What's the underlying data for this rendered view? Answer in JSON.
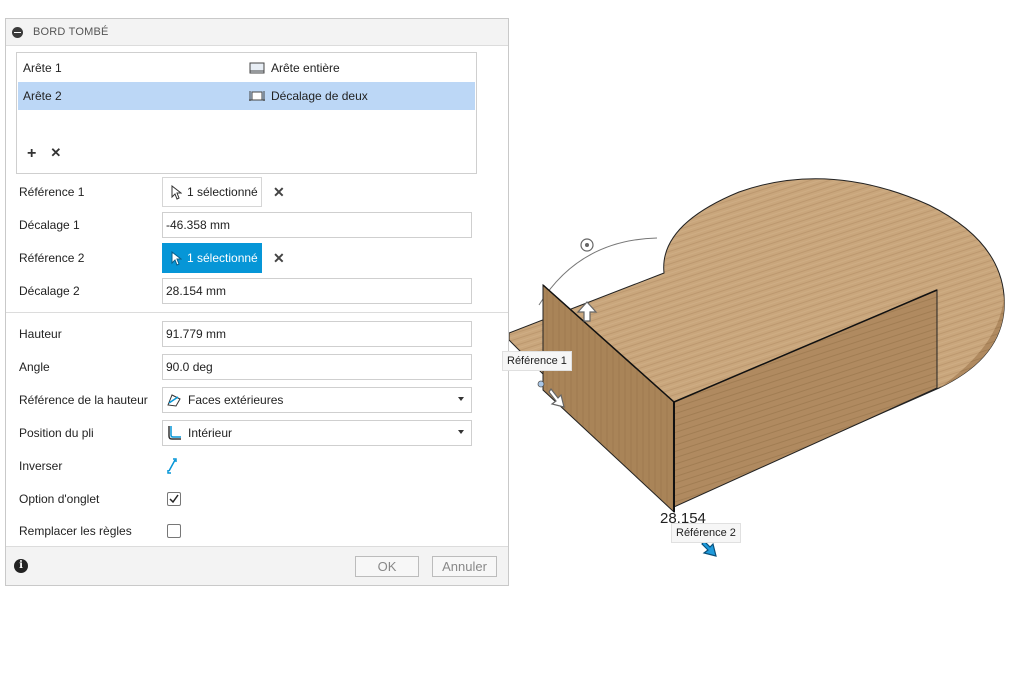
{
  "dialog": {
    "title": "BORD TOMBÉ",
    "edges": [
      {
        "name": "Arête 1",
        "type": "Arête entière",
        "selected": false
      },
      {
        "name": "Arête 2",
        "type": "Décalage de deux",
        "selected": true
      }
    ],
    "add_icon": "+",
    "remove_icon": "✕",
    "reference1_label": "Référence 1",
    "reference1_value": "1 sélectionné",
    "offset1_label": "Décalage 1",
    "offset1_value": "-46.358 mm",
    "reference2_label": "Référence 2",
    "reference2_value": "1 sélectionné",
    "offset2_label": "Décalage 2",
    "offset2_value": "28.154 mm",
    "height_label": "Hauteur",
    "height_value": "91.779 mm",
    "angle_label": "Angle",
    "angle_value": "90.0 deg",
    "height_ref_label": "Référence de la hauteur",
    "height_ref_value": "Faces extérieures",
    "bend_pos_label": "Position du pli",
    "bend_pos_value": "Intérieur",
    "flip_label": "Inverser",
    "miter_label": "Option d'onglet",
    "miter_checked": true,
    "override_label": "Remplacer les règles",
    "override_checked": false,
    "clear_icon": "✕",
    "info_icon": "i",
    "ok_label": "OK",
    "cancel_label": "Annuler"
  },
  "viewport": {
    "tag_ref1": "Référence 1",
    "tag_ref2": "Référence 2",
    "dimension_text": "28.154"
  },
  "colors": {
    "accent": "#0696d7",
    "selection": "#bcd7f6",
    "wood": "#c9a67c"
  }
}
